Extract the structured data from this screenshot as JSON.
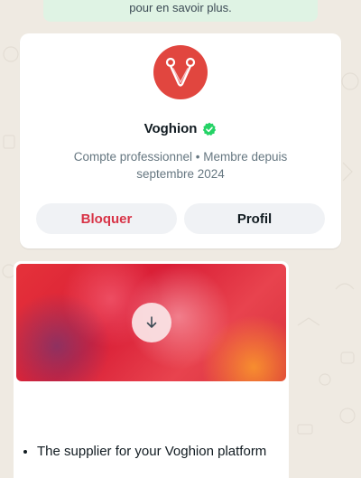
{
  "system_banner": {
    "text": "pour en savoir plus."
  },
  "profile": {
    "name": "Voghion",
    "verified_icon": "verified-badge-icon",
    "subtitle": "Compte professionnel • Membre depuis septembre 2024",
    "avatar_color": "#e1463f",
    "verified_color": "#25d366",
    "block_label": "Bloquer",
    "block_color": "#d83447",
    "profile_label": "Profil"
  },
  "message": {
    "media_icon": "download-arrow-icon",
    "list_items": [
      "The supplier for your Voghion platform"
    ]
  }
}
